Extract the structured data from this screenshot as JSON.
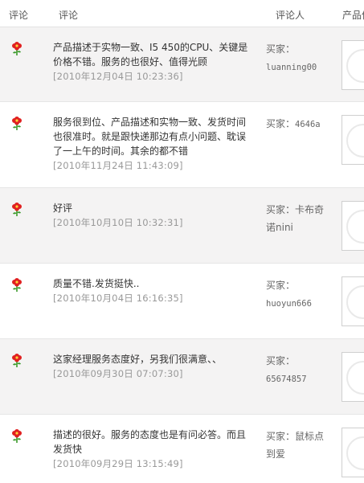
{
  "header": {
    "rating": "评论",
    "comment": "评论",
    "reviewer": "评论人",
    "product": "产品信息"
  },
  "icons": {
    "rating": "red-flower-icon",
    "product_thumb": "product-thumbnail-placeholder"
  },
  "colors": {
    "flower_red": "#e02020",
    "flower_leaf": "#3a9a2a",
    "date_gray": "#999999",
    "row_shade": "#f4f3f3"
  },
  "reviews": [
    {
      "text": "产品描述于实物一致、I5 450的CPU、关键是价格不错。服务的也很好、值得光顾",
      "date": "[2010年12月04日 10:23:36]",
      "buyer_label": "买家：",
      "buyer_name": "luanning00"
    },
    {
      "text": "服务很到位、产品描述和实物一致、发货时间也很准时。就是跟快递那边有点小问题、耽误了一上午的时间。其余的都不错",
      "date": "[2010年11月24日 11:43:09]",
      "buyer_label": "买家：",
      "buyer_name": "4646a"
    },
    {
      "text": "好评",
      "date": "[2010年10月10日 10:32:31]",
      "buyer_label": "买家：",
      "buyer_name": "卡布奇诺nini"
    },
    {
      "text": "质量不错.发货挺快..",
      "date": "[2010年10月04日 16:16:35]",
      "buyer_label": "买家：",
      "buyer_name": "huoyun666"
    },
    {
      "text": "这家经理服务态度好，另我们很满意、、",
      "date": "[2010年09月30日 07:07:30]",
      "buyer_label": "买家：",
      "buyer_name": "65674857"
    },
    {
      "text": "描述的很好。服务的态度也是有问必答。而且发货快",
      "date": "[2010年09月29日 13:15:49]",
      "buyer_label": "买家：",
      "buyer_name": "鼠标点到爱"
    }
  ]
}
